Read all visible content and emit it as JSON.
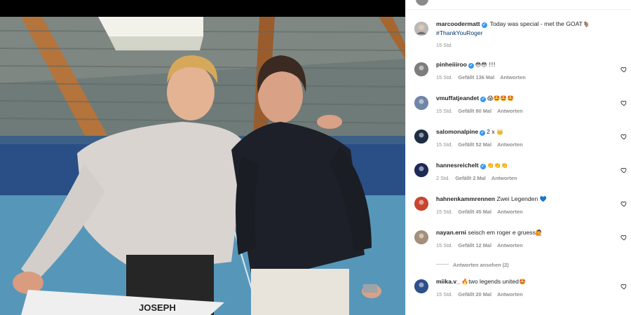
{
  "photo": {
    "alt_icon": "photo-post",
    "net_brand": "JOSEPH"
  },
  "caption": {
    "username": "marcoodermatt",
    "verified": true,
    "text": "Today was special - met the GOAT",
    "emoji": "🐐",
    "hashtag": "#ThankYouRoger",
    "time": "15 Std."
  },
  "comments": [
    {
      "username": "pinheiiiroo",
      "verified": true,
      "text": "",
      "emoji": "😳😳 !!!",
      "time": "15 Std.",
      "likes": "Gefällt 136 Mal",
      "reply": "Antworten",
      "avatar_color": "#7d7d7d"
    },
    {
      "username": "vmuffatjeandet",
      "verified": true,
      "text": "",
      "emoji": "😱🤩🤩🤩",
      "time": "15 Std.",
      "likes": "Gefällt 80 Mal",
      "reply": "Antworten",
      "avatar_color": "#6f86a8"
    },
    {
      "username": "salomonalpine",
      "verified": true,
      "text": "2 x ",
      "emoji": "👑",
      "time": "15 Std.",
      "likes": "Gefällt 52 Mal",
      "reply": "Antworten",
      "avatar_color": "#1f2d44"
    },
    {
      "username": "hannesreichelt",
      "verified": true,
      "text": "",
      "emoji": "👏👏👏",
      "time": "2 Std.",
      "likes": "Gefällt 2 Mal",
      "reply": "Antworten",
      "avatar_color": "#1b2a57"
    },
    {
      "username": "hahnenkammrennen",
      "verified": false,
      "text": "Zwei Legenden ",
      "emoji": "💙",
      "time": "15 Std.",
      "likes": "Gefällt 45 Mal",
      "reply": "Antworten",
      "avatar_color": "#c8452e"
    },
    {
      "username": "nayan.erni",
      "verified": false,
      "text": "seisch em roger e gruess",
      "emoji": "🙋",
      "time": "15 Std.",
      "likes": "Gefällt 12 Mal",
      "reply": "Antworten",
      "avatar_color": "#a58f7a"
    },
    {
      "username": "miika.v_",
      "verified": false,
      "text": "two legends united",
      "emoji": "🔥",
      "emoji2": "🤩",
      "time": "15 Std.",
      "likes": "Gefällt 20 Mal",
      "reply": "Antworten",
      "avatar_color": "#2d4f8a"
    }
  ],
  "view_replies": "Antworten ansehen (2)",
  "colors": {
    "verified": "#3897f0",
    "hashtag": "#00376b",
    "muted": "#8e8e8e"
  }
}
